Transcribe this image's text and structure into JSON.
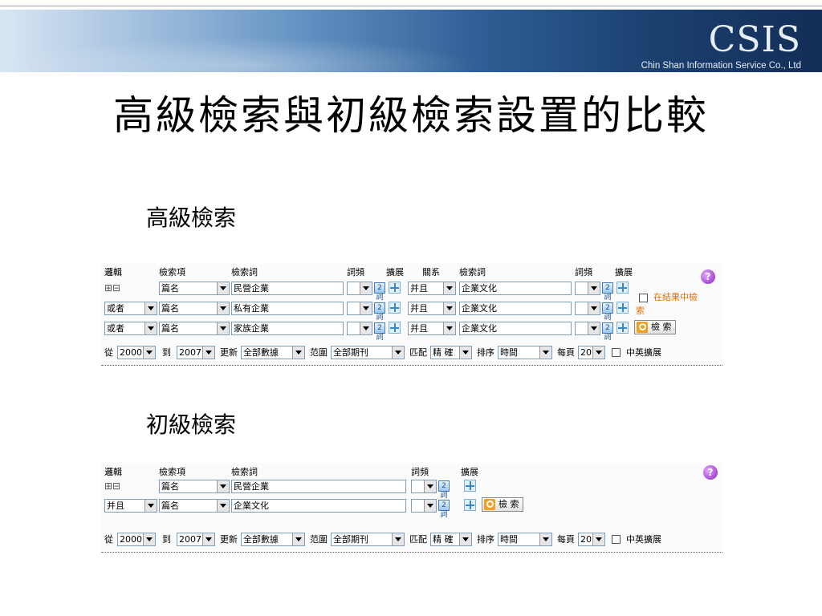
{
  "banner": {
    "logo": "CSIS",
    "company": "Chin Shan Information Service Co., Ltd"
  },
  "slide_title": "高級檢索與初級檢索設置的比較",
  "advanced": {
    "section_title": "高級檢索",
    "headers": {
      "logic": "邏輯",
      "field": "檢索項",
      "term": "檢索詞",
      "freq": "詞頻",
      "expand": "擴展",
      "relation": "關系",
      "term2": "檢索詞",
      "freq2": "詞頻",
      "expand2": "擴展"
    },
    "toggle": "⊞⊟",
    "rows": [
      {
        "logic": "",
        "field": "篇名",
        "term": "民營企業",
        "relation": "并且",
        "term2": "企業文化"
      },
      {
        "logic": "或者",
        "field": "篇名",
        "term": "私有企業",
        "relation": "并且",
        "term2": "企業文化"
      },
      {
        "logic": "或者",
        "field": "篇名",
        "term": "家族企業",
        "relation": "并且",
        "term2": "企業文化"
      }
    ],
    "in_results_line1": "在結果中檢",
    "in_results_line2": "索",
    "search_button": "檢 索"
  },
  "basic": {
    "section_title": "初級檢索",
    "headers": {
      "logic": "邏輯",
      "field": "檢索項",
      "term": "檢索詞",
      "freq": "詞頻",
      "expand": "擴展"
    },
    "toggle": "⊞⊟",
    "rows": [
      {
        "logic": "",
        "field": "篇名",
        "term": "民營企業"
      },
      {
        "logic": "并且",
        "field": "篇名",
        "term": "企業文化"
      }
    ],
    "search_button": "檢 索"
  },
  "filters": {
    "from_label": "從",
    "from_value": "2000",
    "to_label": "到",
    "to_value": "2007",
    "update_label": "更新",
    "update_value": "全部數據",
    "range_label": "范圍",
    "range_value": "全部期刊",
    "match_label": "匹配",
    "match_value": "精 確",
    "sort_label": "排序",
    "sort_value": "時間",
    "perpage_label": "每頁",
    "perpage_value": "20",
    "cn_en_label": "中英擴展"
  },
  "help_icon": "?",
  "freq_icon_text": "2詞"
}
